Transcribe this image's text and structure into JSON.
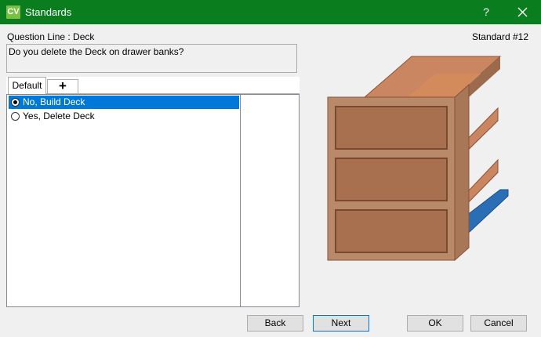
{
  "window": {
    "icon_text": "CV",
    "title": "Standards",
    "help_label": "?"
  },
  "question": {
    "line_label": "Question Line : Deck",
    "standard_label": "Standard #12",
    "text": "Do you delete the Deck on drawer banks?"
  },
  "tabs": {
    "default_label": "Default",
    "add_label": "+"
  },
  "options": [
    {
      "label": "No, Build Deck",
      "selected": true
    },
    {
      "label": "Yes, Delete Deck",
      "selected": false
    }
  ],
  "preview": {
    "cabinet_face_color": "#b88a6a",
    "panel_color": "#a8704e",
    "deck_color": "#2a6fb6",
    "shelf_color": "#d48b5c"
  },
  "buttons": {
    "back": "Back",
    "next": "Next",
    "ok": "OK",
    "cancel": "Cancel"
  },
  "colors": {
    "titlebar": "#0a7d1f",
    "selection": "#0078d7"
  }
}
